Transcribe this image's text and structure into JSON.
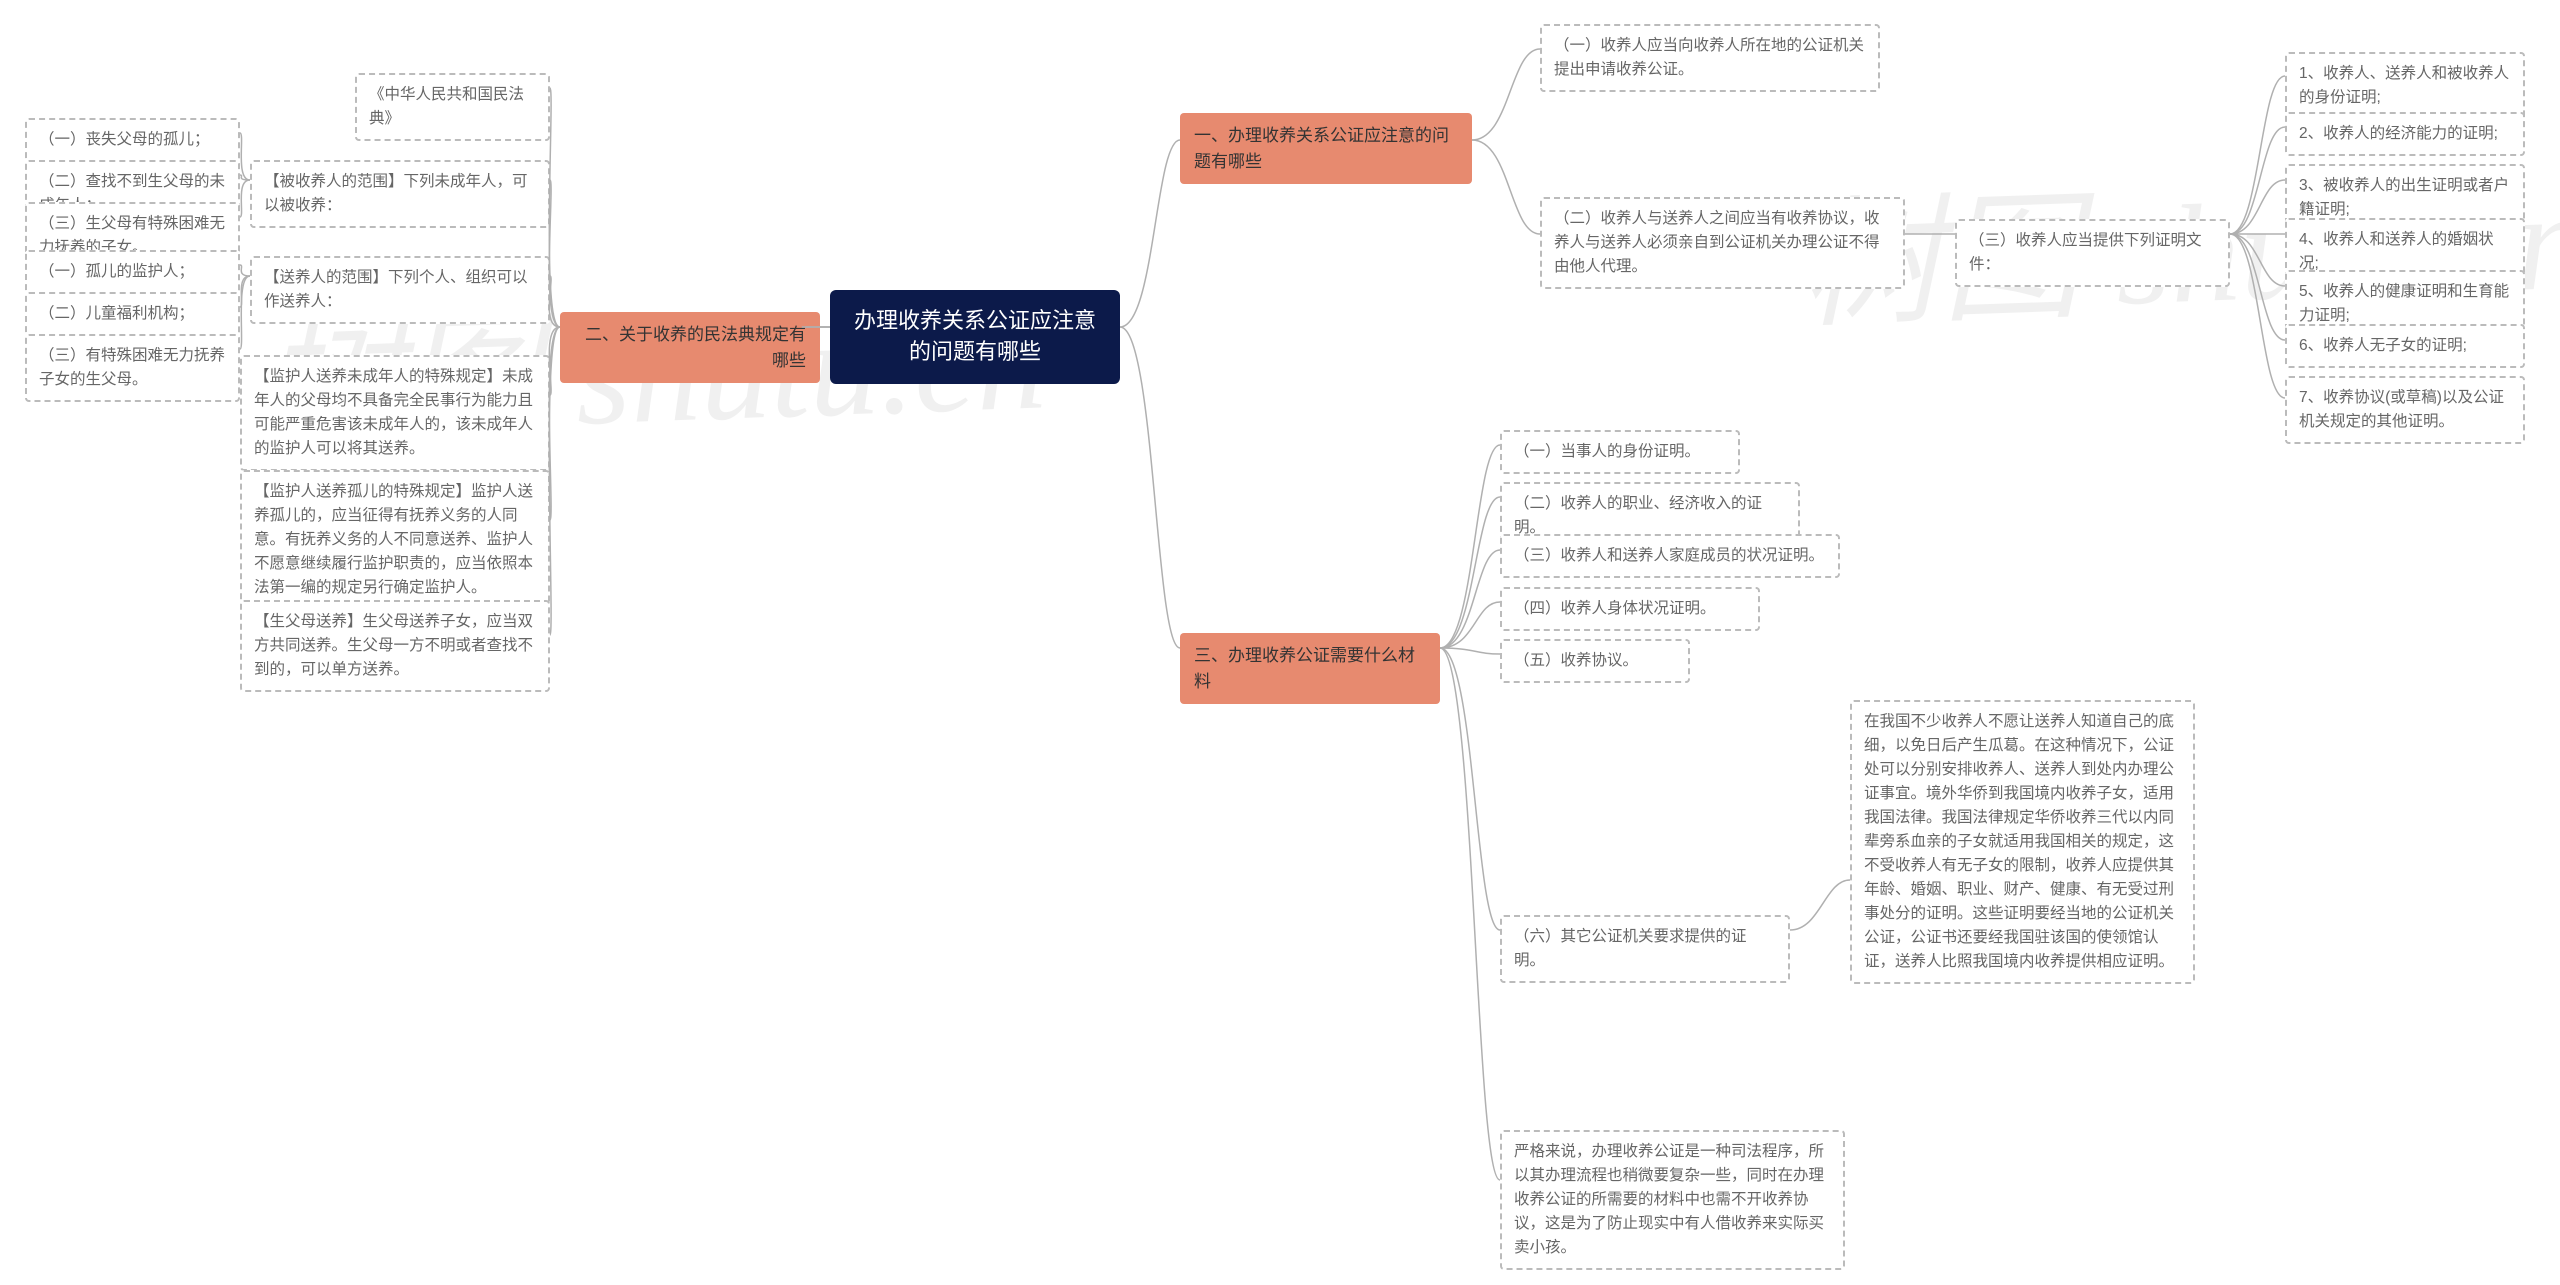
{
  "watermark": "树图 shutu.cn",
  "root": {
    "title": "办理收养关系公证应注意的问题有哪些"
  },
  "branches": {
    "b1": {
      "title": "一、办理收养关系公证应注意的问题有哪些",
      "items": {
        "i1": "（一）收养人应当向收养人所在地的公证机关提出申请收养公证。",
        "i2": "（二）收养人与送养人之间应当有收养协议，收养人与送养人必须亲自到公证机关办理公证不得由他人代理。",
        "i3": "（三）收养人应当提供下列证明文件：",
        "docs": {
          "d1": "1、收养人、送养人和被收养人的身份证明;",
          "d2": "2、收养人的经济能力的证明;",
          "d3": "3、被收养人的出生证明或者户籍证明;",
          "d4": "4、收养人和送养人的婚姻状况;",
          "d5": "5、收养人的健康证明和生育能力证明;",
          "d6": "6、收养人无子女的证明;",
          "d7": "7、收养协议(或草稿)以及公证机关规定的其他证明。"
        }
      }
    },
    "b2": {
      "title": "二、关于收养的民法典规定有哪些",
      "items": {
        "code": "《中华人民共和国民法典》",
        "adoptee_scope": "【被收养人的范围】下列未成年人，可以被收养：",
        "adoptee": {
          "a1": "（一）丧失父母的孤儿；",
          "a2": "（二）查找不到生父母的未成年人；",
          "a3": "（三）生父母有特殊困难无力抚养的子女。"
        },
        "sender_scope": "【送养人的范围】下列个人、组织可以作送养人：",
        "sender": {
          "s1": "（一）孤儿的监护人；",
          "s2": "（二）儿童福利机构；",
          "s3": "（三）有特殊困难无力抚养子女的生父母。"
        },
        "g1": "【监护人送养未成年人的特殊规定】未成年人的父母均不具备完全民事行为能力且可能严重危害该未成年人的，该未成年人的监护人可以将其送养。",
        "g2": "【监护人送养孤儿的特殊规定】监护人送养孤儿的，应当征得有抚养义务的人同意。有抚养义务的人不同意送养、监护人不愿意继续履行监护职责的，应当依照本法第一编的规定另行确定监护人。",
        "g3": "【生父母送养】生父母送养子女，应当双方共同送养。生父母一方不明或者查找不到的，可以单方送养。"
      }
    },
    "b3": {
      "title": "三、办理收养公证需要什么材料",
      "items": {
        "m1": "（一）当事人的身份证明。",
        "m2": "（二）收养人的职业、经济收入的证明。",
        "m3": "（三）收养人和送养人家庭成员的状况证明。",
        "m4": "（四）收养人身体状况证明。",
        "m5": "（五）收养协议。",
        "m6": "（六）其它公证机关要求提供的证明。",
        "m6_detail": "在我国不少收养人不愿让送养人知道自己的底细，以免日后产生瓜葛。在这种情况下，公证处可以分别安排收养人、送养人到处内办理公证事宜。境外华侨到我国境内收养子女，适用我国法律。我国法律规定华侨收养三代以内同辈旁系血亲的子女就适用我国相关的规定，这不受收养人有无子女的限制，收养人应提供其年龄、婚姻、职业、财产、健康、有无受过刑事处分的证明。这些证明要经当地的公证机关公证，公证书还要经我国驻该国的使领馆认证，送养人比照我国境内收养提供相应证明。",
        "m_note": "严格来说，办理收养公证是一种司法程序，所以其办理流程也稍微要复杂一些，同时在办理收养公证的所需要的材料中也需不开收养协议，这是为了防止现实中有人借收养来实际买卖小孩。"
      }
    }
  }
}
